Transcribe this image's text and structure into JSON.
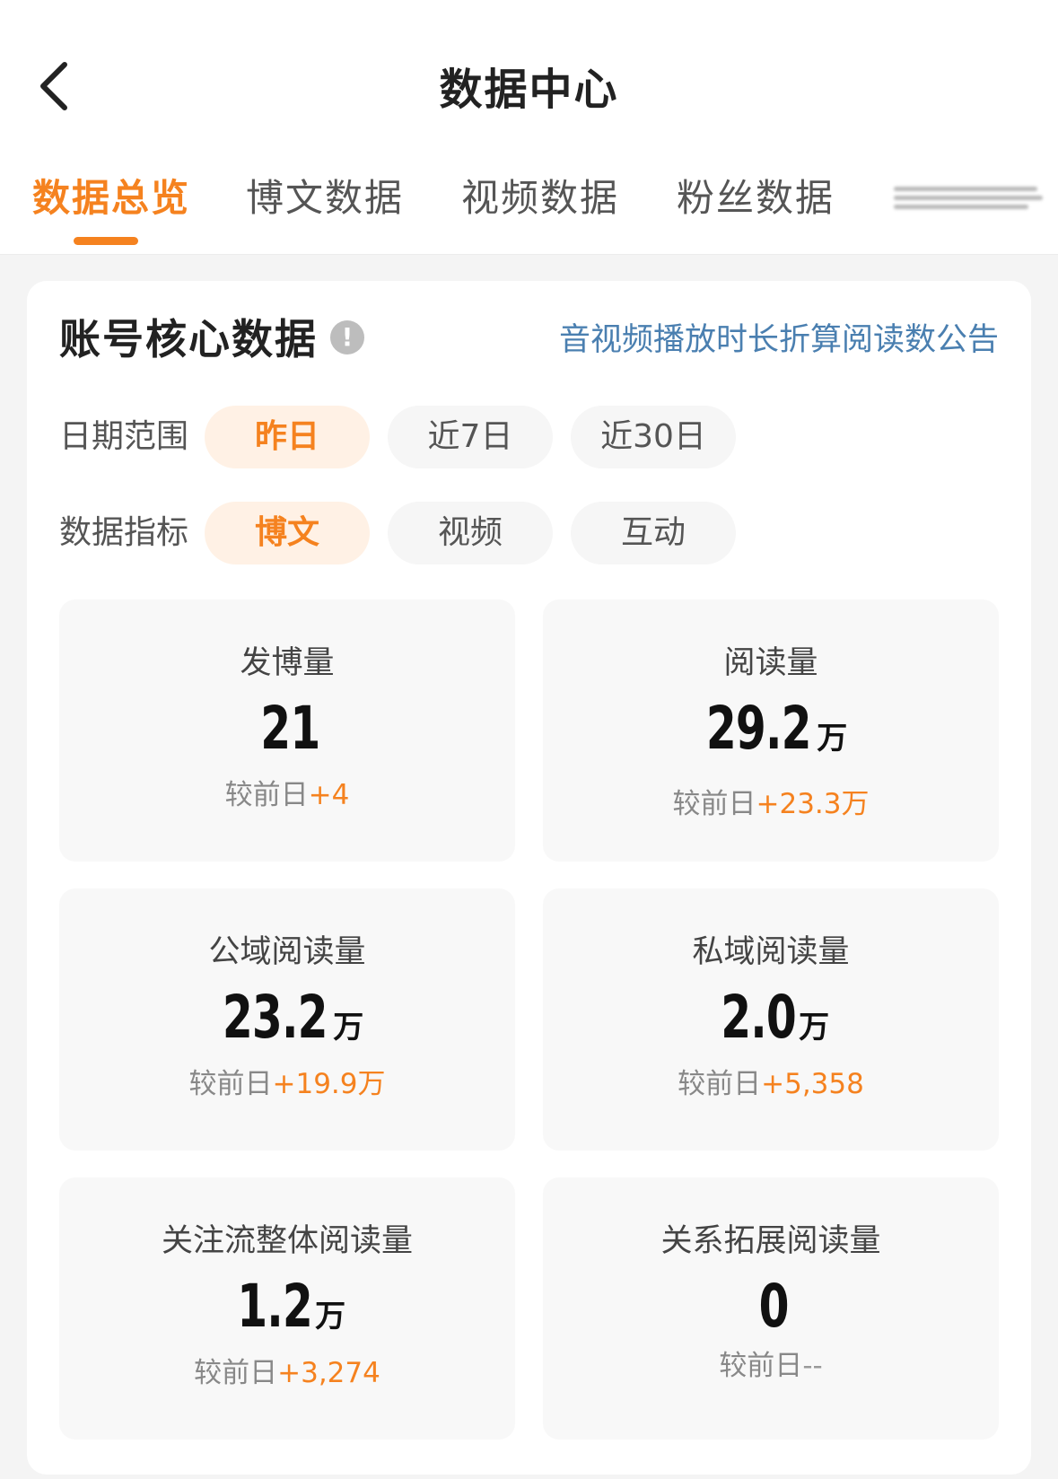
{
  "header": {
    "title": "数据中心",
    "back_icon": "chevron-left-icon"
  },
  "tabs": [
    {
      "label": "数据总览",
      "active": true
    },
    {
      "label": "博文数据",
      "active": false
    },
    {
      "label": "视频数据",
      "active": false
    },
    {
      "label": "粉丝数据",
      "active": false
    }
  ],
  "card": {
    "title": "账号核心数据",
    "info_icon": "!",
    "notice_link": "音视频播放时长折算阅读数公告",
    "date_range": {
      "label": "日期范围",
      "options": [
        "昨日",
        "近7日",
        "近30日"
      ],
      "selected": "昨日"
    },
    "metric": {
      "label": "数据指标",
      "options": [
        "博文",
        "视频",
        "互动"
      ],
      "selected": "博文"
    },
    "stats": [
      {
        "label": "发博量",
        "value": "21",
        "unit": "",
        "compare_label": "较前日",
        "delta": "+4"
      },
      {
        "label": "阅读量",
        "value": "29.2",
        "unit": "万",
        "compare_label": "较前日",
        "delta": "+23.3万"
      },
      {
        "label": "公域阅读量",
        "value": "23.2",
        "unit": "万",
        "compare_label": "较前日",
        "delta": "+19.9万"
      },
      {
        "label": "私域阅读量",
        "value": "2.0",
        "unit": "万",
        "compare_label": "较前日",
        "delta": "+5,358"
      },
      {
        "label": "关注流整体阅读量",
        "value": "1.2",
        "unit": "万",
        "compare_label": "较前日",
        "delta": "+3,274"
      },
      {
        "label": "关系拓展阅读量",
        "value": "0",
        "unit": "",
        "compare_label": "较前日",
        "delta": "--"
      }
    ]
  },
  "colors": {
    "accent": "#f5821f",
    "link": "#4a7fb0",
    "background": "#f4f4f4"
  }
}
